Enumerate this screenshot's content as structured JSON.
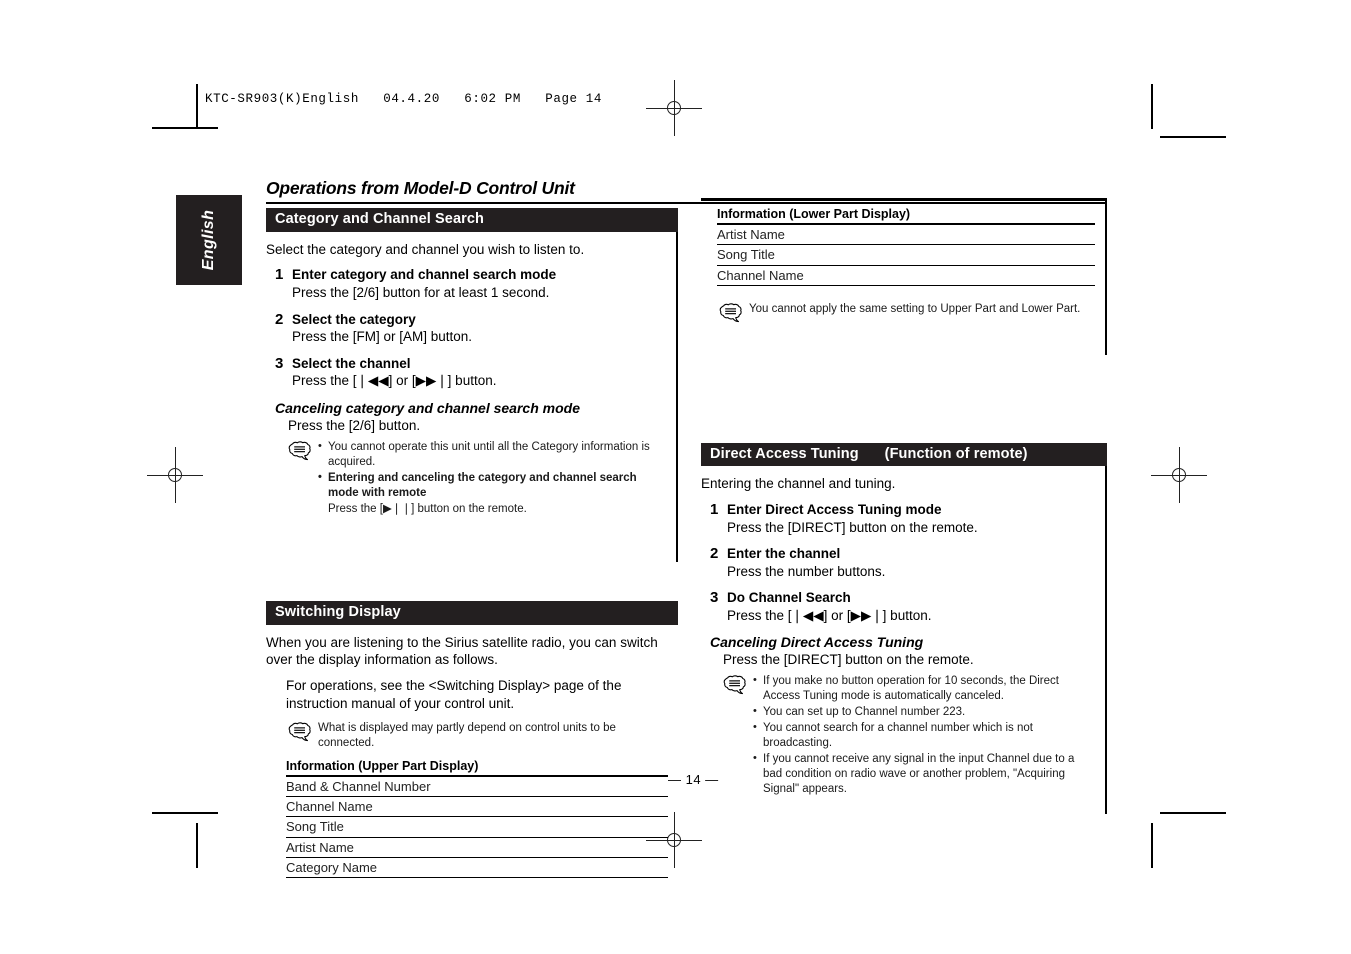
{
  "print_slug": "KTC-SR903(K)English   04.4.20   6:02 PM   Page 14",
  "language_tab": "English",
  "page_title": "Operations from Model-D Control Unit",
  "page_number": "— 14 —",
  "left_column": {
    "category_section": {
      "heading": "Category and Channel Search",
      "lead": "Select the category and channel you wish to listen to.",
      "steps": [
        {
          "num": "1",
          "title": "Enter category and channel search mode",
          "desc": "Press the [2/6] button for at least 1 second."
        },
        {
          "num": "2",
          "title": "Select the category",
          "desc": "Press the [FM] or [AM] button."
        },
        {
          "num": "3",
          "title": "Select the channel",
          "desc": "Press the [❘◀◀] or [▶▶❘] button."
        }
      ],
      "cancel_title": "Canceling category and channel search mode",
      "cancel_desc": "Press the [2/6] button.",
      "notes": [
        "You cannot operate this unit until all the Category information is acquired.",
        "Entering and canceling the category and channel search mode with remote",
        "Press the [▶❘❘] button on the remote."
      ]
    },
    "switching_section": {
      "heading": "Switching Display",
      "lead": "When you are listening to the Sirius satellite radio, you can switch over the display information as follows.",
      "lead2": "For operations, see the <Switching Display> page of the instruction manual of your control unit.",
      "note": "What is displayed may partly depend on control units to be connected.",
      "info_title": "Information (Upper Part Display)",
      "info_rows": [
        "Band & Channel Number",
        "Channel Name",
        "Song Title",
        "Artist Name",
        "Category Name"
      ]
    }
  },
  "right_column": {
    "lower_info": {
      "info_title": "Information (Lower Part Display)",
      "info_rows": [
        "Artist Name",
        "Song Title",
        "Channel Name"
      ],
      "note": "You cannot apply the same setting to Upper Part and Lower Part."
    },
    "direct_access": {
      "heading": "Direct Access Tuning",
      "heading_suffix": "(Function of remote)",
      "lead": "Entering the channel and tuning.",
      "steps": [
        {
          "num": "1",
          "title": "Enter Direct Access Tuning mode",
          "desc": "Press the [DIRECT] button on the remote."
        },
        {
          "num": "2",
          "title": "Enter the channel",
          "desc": "Press the number buttons."
        },
        {
          "num": "3",
          "title": "Do Channel Search",
          "desc": "Press the [❘◀◀] or [▶▶❘] button."
        }
      ],
      "cancel_title": "Canceling Direct Access Tuning",
      "cancel_desc": "Press the [DIRECT] button on the remote.",
      "notes": [
        "If you make no button operation for 10 seconds, the Direct Access Tuning mode is automatically canceled.",
        "You can set up to Channel number 223.",
        "You cannot search for a channel number which is not broadcasting.",
        "If you cannot receive any signal in the input Channel due to a bad condition on radio wave or another problem, \"Acquiring Signal\" appears."
      ]
    }
  },
  "colors": {
    "heading_bg": "#231f20",
    "text": "#000000"
  }
}
